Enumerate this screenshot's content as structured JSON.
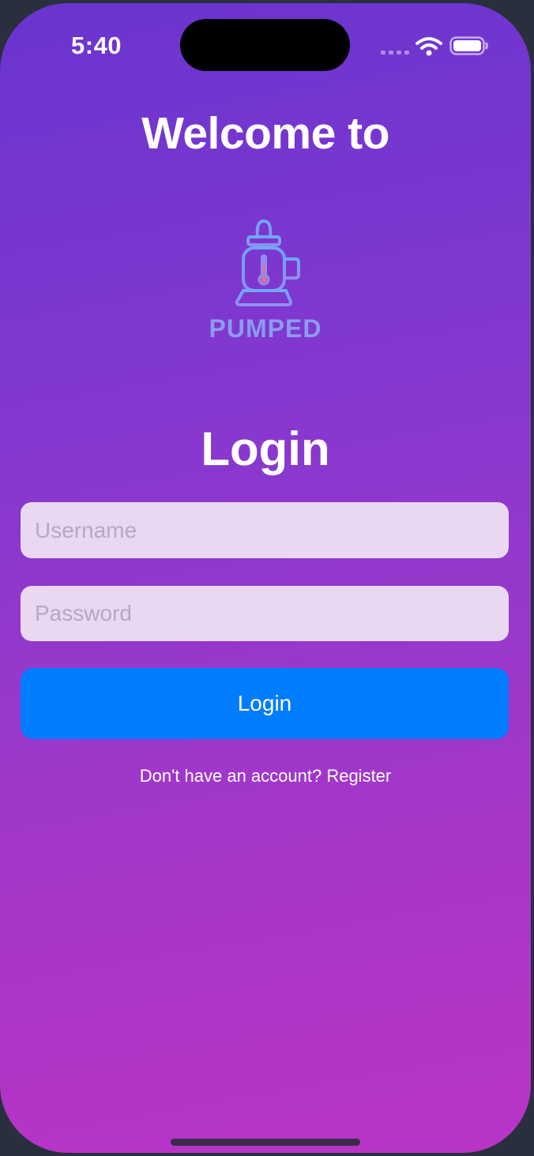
{
  "status_bar": {
    "time": "5:40",
    "icons": [
      "signal-dots-icon",
      "wifi-icon",
      "battery-icon"
    ]
  },
  "header": {
    "welcome_text": "Welcome to"
  },
  "logo": {
    "icon": "baby-bottle-icon",
    "text": "PUMPED"
  },
  "login": {
    "title": "Login",
    "username_placeholder": "Username",
    "username_value": "",
    "password_placeholder": "Password",
    "password_value": "",
    "button_label": "Login",
    "register_prompt": "Don't have an account? Register"
  },
  "colors": {
    "gradient_top": "#6a34cf",
    "gradient_bottom": "#b934c6",
    "button": "#007cff",
    "input_background": "#ead8f2",
    "logo_blue": "#8b9cf0",
    "thermometer_accent": "#e06f9a"
  }
}
